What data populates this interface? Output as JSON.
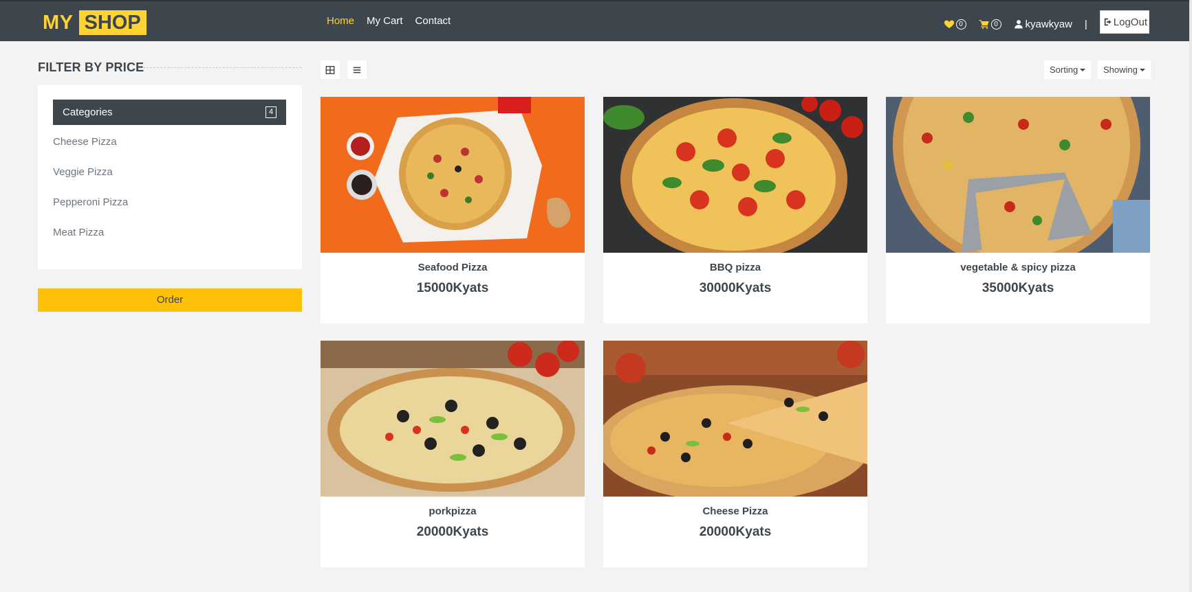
{
  "brand": {
    "part1": "MY",
    "part2": "SHOP"
  },
  "nav": {
    "links": [
      {
        "label": "Home",
        "active": true
      },
      {
        "label": "My Cart",
        "active": false
      },
      {
        "label": "Contact",
        "active": false
      }
    ]
  },
  "header_right": {
    "wishlist_count": "0",
    "cart_count": "0",
    "username": "kyawkyaw",
    "separator": "|",
    "logout_label": "LogOut"
  },
  "sidebar": {
    "filter_title": "FILTER BY PRICE",
    "categories_label": "Categories",
    "categories_count": "4",
    "items": [
      "Cheese Pizza",
      "Veggie Pizza",
      "Pepperoni Pizza",
      "Meat Pizza"
    ],
    "order_label": "Order"
  },
  "toolbar": {
    "sorting_label": "Sorting",
    "showing_label": "Showing"
  },
  "products": [
    {
      "name": "Seafood Pizza",
      "price": "15000Kyats",
      "bg": "#f26a1b"
    },
    {
      "name": "BBQ pizza",
      "price": "30000Kyats",
      "bg": "#2f3132"
    },
    {
      "name": "vegetable & spicy pizza",
      "price": "35000Kyats",
      "bg": "#4e5e70"
    },
    {
      "name": "porkpizza",
      "price": "20000Kyats",
      "bg": "#c9a77c"
    },
    {
      "name": "Cheese Pizza",
      "price": "20000Kyats",
      "bg": "#b57a45"
    }
  ],
  "colors": {
    "navbar": "#3d464d",
    "accent": "#ffd333",
    "order_button": "#ffc107",
    "background": "#f3f3f3"
  }
}
